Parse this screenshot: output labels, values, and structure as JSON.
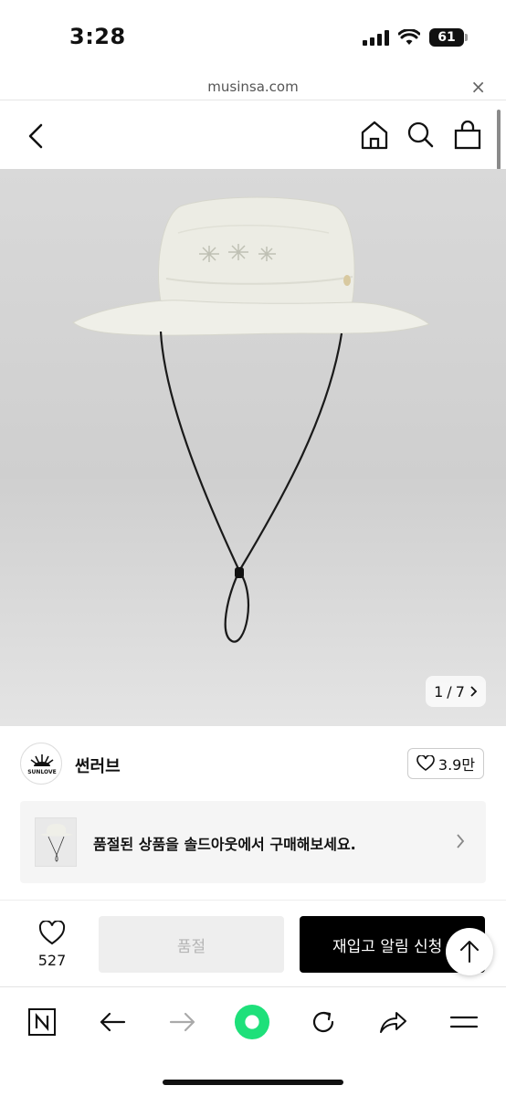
{
  "status": {
    "time": "3:28",
    "battery": "61"
  },
  "browser": {
    "url": "musinsa.com",
    "close": "×"
  },
  "gallery": {
    "current": "1",
    "separator": "/",
    "total": "7"
  },
  "brand": {
    "name": "썬러브",
    "logo_text": "SUNLOVE",
    "likes": "3.9만"
  },
  "soldout_banner": {
    "text": "품절된 상품을 솔드아웃에서 구매해보세요."
  },
  "purchase": {
    "wish_count": "527",
    "soldout_label": "품절",
    "restock_label": "재입고 알림 신청"
  },
  "colors": {
    "accent_green": "#1ee07a",
    "black": "#000000",
    "disabled_bg": "#eeeeee"
  }
}
